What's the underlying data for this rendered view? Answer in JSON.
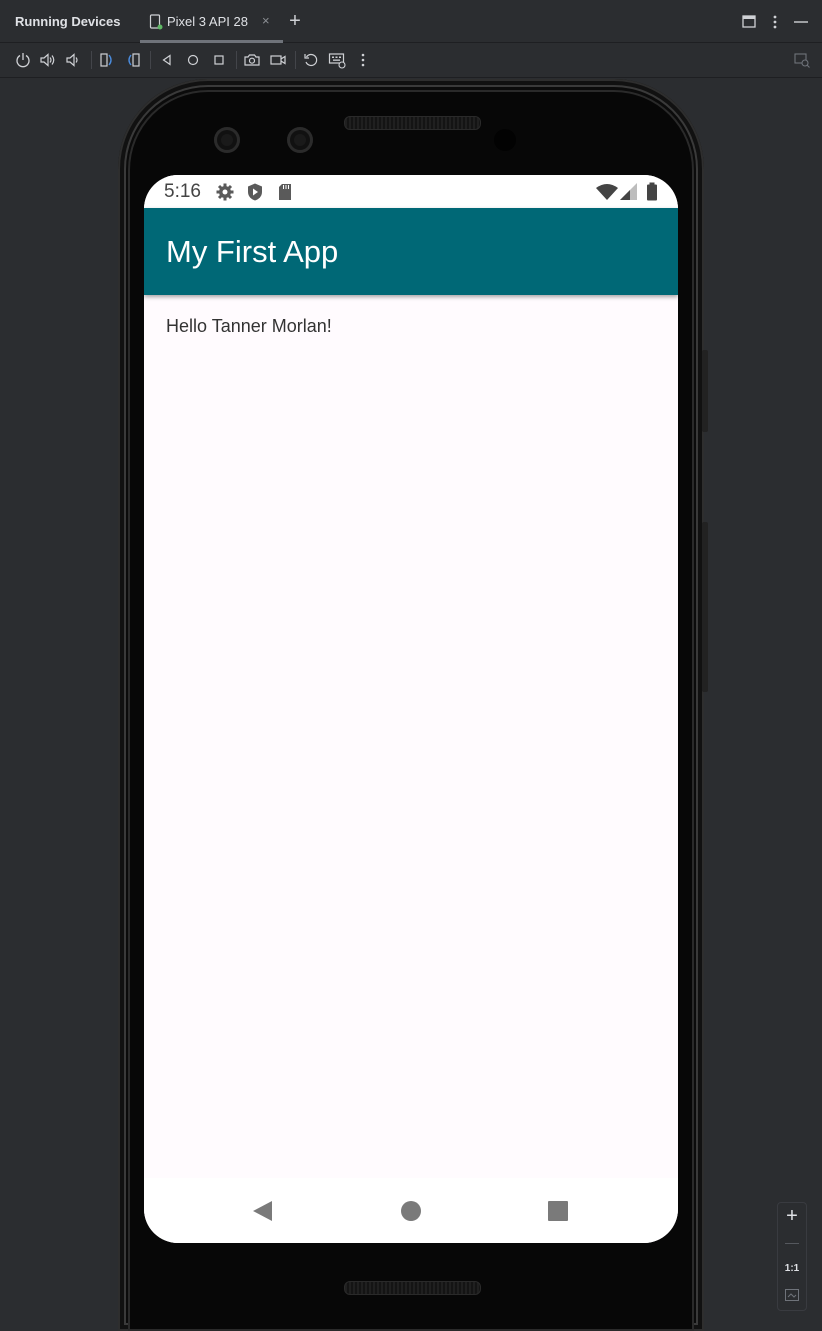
{
  "tool_window": {
    "title": "Running Devices",
    "tab": {
      "label": "Pixel 3 API 28",
      "close_icon": "close-icon"
    },
    "add_tab_label": "+"
  },
  "toolbar": {
    "buttons": [
      "power-icon",
      "volume-up-icon",
      "volume-down-icon",
      "rotate-left-icon",
      "rotate-right-icon",
      "back-icon",
      "home-icon",
      "overview-icon",
      "screenshot-icon",
      "screen-record-icon",
      "reset-icon",
      "keyboard-icon",
      "more-icon",
      "display-options-icon"
    ]
  },
  "device": {
    "status_bar": {
      "time": "5:16"
    },
    "app": {
      "title": "My First App",
      "greeting": "Hello Tanner Morlan!"
    },
    "colors": {
      "app_bar": "#006876",
      "screen_bg": "#fffbfe"
    }
  },
  "zoom": {
    "zoom_in": "+",
    "actual_size": "1:1"
  }
}
